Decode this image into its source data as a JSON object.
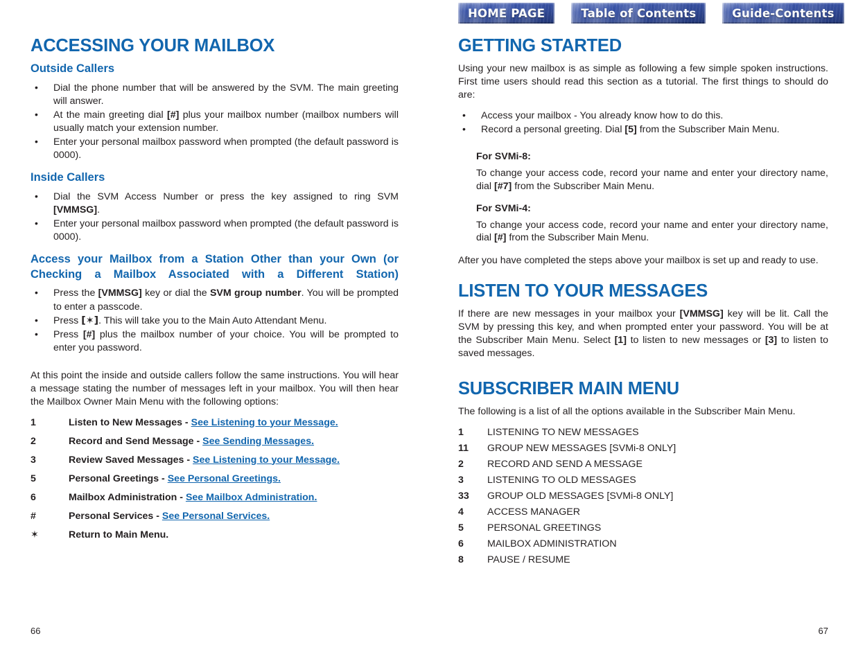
{
  "nav": {
    "buttons": [
      {
        "label": "HOME PAGE",
        "name": "home-page"
      },
      {
        "label": "Table of Contents",
        "name": "table-of-contents"
      },
      {
        "label": "Guide-Contents",
        "name": "guide-contents"
      }
    ]
  },
  "colors": {
    "heading_blue": "#1266ae",
    "link_blue": "#1266ae",
    "body_black": "#231f20",
    "button_blue": "#3551a8"
  },
  "left": {
    "title": "ACCESSING YOUR MAILBOX",
    "outside": {
      "heading": "Outside Callers",
      "bullets": [
        {
          "pre": "Dial the phone number that will be answered by the SVM. The main greeting will answer.",
          "bold": "",
          "post": ""
        },
        {
          "pre": "At the main greeting dial ",
          "bold": "[#]",
          "post": " plus your mailbox number (mailbox numbers will usually match your extension number."
        },
        {
          "pre": "Enter your personal mailbox password when prompted (the default password is 0000).",
          "bold": "",
          "post": ""
        }
      ]
    },
    "inside": {
      "heading": "Inside Callers",
      "bullets": [
        {
          "pre": "Dial the SVM Access Number or press the key assigned to ring SVM ",
          "bold": "[VMMSG]",
          "post": "."
        },
        {
          "pre": "Enter your personal mailbox password when prompted (the default password  is 0000).",
          "bold": "",
          "post": ""
        }
      ]
    },
    "station": {
      "heading_line1": "Access your Mailbox from a Station Other than your Own",
      "heading_line2": "(or Checking a Mailbox Associated with a Different Station)",
      "bullets": [
        {
          "pre": "Press the ",
          "bold": "[VMMSG]",
          "mid": " key or dial the ",
          "bold2": "SVM group number",
          "post": ". You will be prompted to enter a passcode."
        },
        {
          "pre": "Press ",
          "bold": "[✶]",
          "mid": "",
          "bold2": "",
          "post": ". This will take you to the Main Auto Attendant Menu."
        },
        {
          "pre": "Press ",
          "bold": "[#]",
          "mid": "",
          "bold2": "",
          "post": " plus the mailbox number of your choice. You will be prompted to enter you password."
        }
      ]
    },
    "closing_paragraph": "At this point the inside and outside callers follow the same instructions. You will hear a message stating the number of messages left in your mailbox. You will then hear the Mailbox Owner Main Menu with the following options:",
    "options": [
      {
        "key": "1",
        "label": "Listen to New Messages - ",
        "link": "See Listening to your Message."
      },
      {
        "key": "2",
        "label": "Record and Send Message - ",
        "link": "See Sending Messages."
      },
      {
        "key": "3",
        "label": "Review Saved Messages - ",
        "link": "See Listening to your Message."
      },
      {
        "key": "5",
        "label": "Personal Greetings - ",
        "link": "See Personal Greetings."
      },
      {
        "key": "6",
        "label": "Mailbox Administration - ",
        "link": "See Mailbox Administration. "
      },
      {
        "key": "#",
        "label": "Personal Services - ",
        "link": "See Personal Services."
      },
      {
        "key": "✶",
        "label": "Return to Main Menu.",
        "link": ""
      }
    ],
    "page_number": "66"
  },
  "right": {
    "getting_started": {
      "title": "GETTING STARTED",
      "intro": "Using your new mailbox is as simple as following a few simple spoken instructions. First time users should read this section as a tutorial. The first things to should do are:",
      "bullets": [
        {
          "pre": "Access your mailbox - You already know how to do this.",
          "bold": "",
          "post": ""
        },
        {
          "pre": "Record a personal greeting. Dial ",
          "bold": "[5]",
          "post": " from the Subscriber Main Menu."
        }
      ],
      "subsections": [
        {
          "label": "For SVMi-8:",
          "pre": "To change your access code, record your name and enter your directory name, dial ",
          "bold": "[#7]",
          "post": " from the Subscriber Main Menu."
        },
        {
          "label": "For SVMi-4:",
          "pre": "To change your access code, record your name and enter your directory name, dial ",
          "bold": "[#]",
          "post": " from the Subscriber Main Menu."
        }
      ],
      "closing": "After you have completed the steps above your mailbox is set up and ready to use."
    },
    "listen": {
      "title": "LISTEN TO YOUR MESSAGES",
      "p1_pre": "If there are new messages in your mailbox your ",
      "p1_b1": "[VMMSG]",
      "p1_mid": " key will be lit. Call the SVM by pressing this key, and when prompted enter your password. You will be at the Subscriber Main Menu. Select ",
      "p1_b2": "[1]",
      "p1_mid2": " to listen to new messages or ",
      "p1_b3": "[3]",
      "p1_post": " to listen to saved messages."
    },
    "subscriber": {
      "title": "SUBSCRIBER MAIN MENU",
      "intro": "The following is a list of all the options available in the Subscriber Main Menu.",
      "options": [
        {
          "key": "1",
          "label": "LISTENING TO NEW MESSAGES"
        },
        {
          "key": "11",
          "label": "GROUP NEW MESSAGES [SVMi-8 ONLY]"
        },
        {
          "key": "2",
          "label": "RECORD AND SEND A MESSAGE"
        },
        {
          "key": "3",
          "label": "LISTENING TO OLD MESSAGES"
        },
        {
          "key": "33",
          "label": "GROUP OLD MESSAGES [SVMi-8 ONLY]"
        },
        {
          "key": "4",
          "label": "ACCESS MANAGER"
        },
        {
          "key": "5",
          "label": "PERSONAL GREETINGS"
        },
        {
          "key": "6",
          "label": "MAILBOX ADMINISTRATION"
        },
        {
          "key": "8",
          "label": "PAUSE / RESUME"
        }
      ]
    },
    "page_number": "67"
  }
}
